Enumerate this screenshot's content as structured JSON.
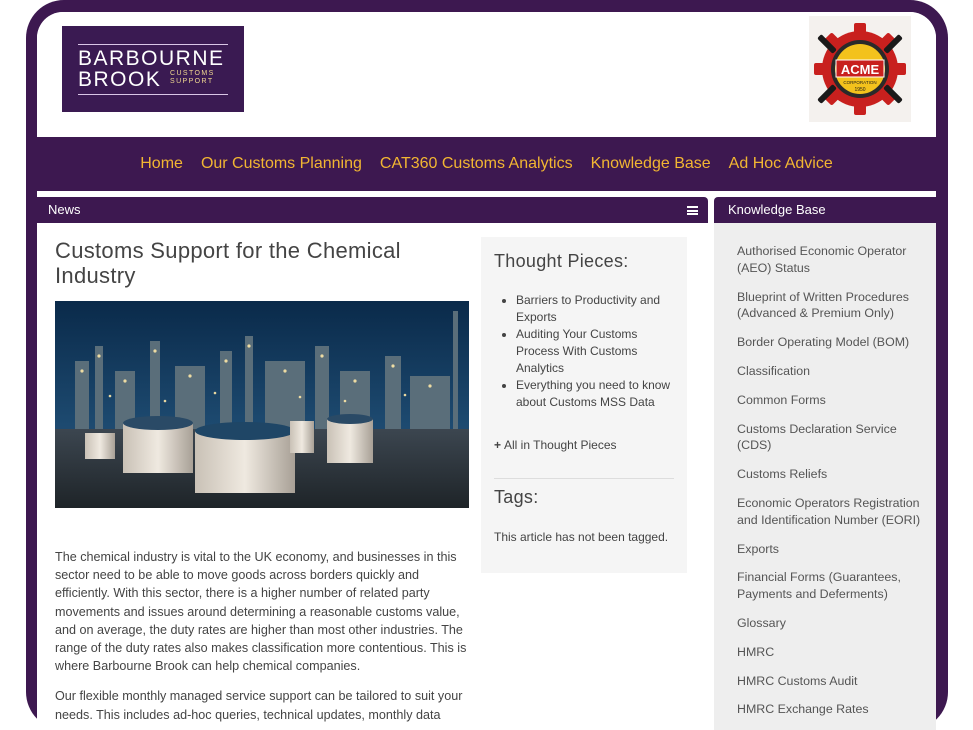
{
  "logo": {
    "line1": "BARBOURNE",
    "line2": "BROOK",
    "tagline": "CUSTOMS SUPPORT"
  },
  "partner_logo": {
    "name": "ACME",
    "subtitle": "CORPORATION",
    "year": "1950"
  },
  "nav": {
    "items": [
      "Home",
      "Our Customs Planning",
      "CAT360 Customs Analytics",
      "Knowledge Base",
      "Ad Hoc Advice"
    ]
  },
  "news_bar": {
    "label": "News"
  },
  "kb_bar": {
    "label": "Knowledge Base"
  },
  "article": {
    "title": "Customs Support for the Chemical Industry",
    "paragraphs": [
      "The chemical industry is vital to the UK economy, and businesses in this sector need to be able to move goods across borders quickly and efficiently. With this sector, there is a higher number of related party movements and issues around determining a reasonable customs value, and on average, the duty rates are higher than most other industries. The range of the duty rates also makes classification more contentious. This is where Barbourne Brook can help chemical companies.",
      "Our flexible monthly managed service support can be tailored to suit your needs.  This includes ad-hoc queries, technical updates, monthly data"
    ]
  },
  "thought_pieces": {
    "title": "Thought Pieces:",
    "items": [
      "Barriers to Productivity and Exports",
      "Auditing Your Customs Process With Customs Analytics",
      "Everything you need to know about Customs MSS Data"
    ],
    "all_link": "All in Thought Pieces"
  },
  "tags": {
    "title": "Tags:",
    "text": "This article has not been tagged."
  },
  "knowledge_base": {
    "items": [
      "Authorised Economic Operator (AEO) Status",
      "Blueprint of Written Procedures (Advanced & Premium Only)",
      "Border Operating Model (BOM)",
      "Classification",
      "Common Forms",
      "Customs Declaration Service (CDS)",
      "Customs Reliefs",
      "Economic Operators Registration and Identification Number (EORI)",
      "Exports",
      "Financial Forms (Guarantees, Payments and Deferments)",
      "Glossary",
      "HMRC",
      "HMRC Customs Audit",
      "HMRC Exchange Rates"
    ]
  },
  "colors": {
    "brand_purple": "#3d1850",
    "nav_link": "#f2b632",
    "sidebar_bg": "#eeeeee"
  }
}
